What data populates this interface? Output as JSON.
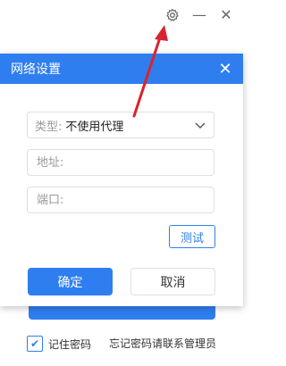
{
  "window": {
    "settings_icon": "gear-icon",
    "minimize_label": "—",
    "close_label": "✕"
  },
  "dialog": {
    "title": "网络设置",
    "close_label": "✕",
    "type_label": "类型:",
    "type_value": "不使用代理",
    "address_placeholder": "地址:",
    "port_placeholder": "端口:",
    "test_label": "测试",
    "ok_label": "确定",
    "cancel_label": "取消"
  },
  "login": {
    "remember_label": "记住密码",
    "forgot_label": "忘记密码请联系管理员"
  },
  "colors": {
    "primary": "#2f7ef0",
    "arrow": "#d9232e"
  }
}
